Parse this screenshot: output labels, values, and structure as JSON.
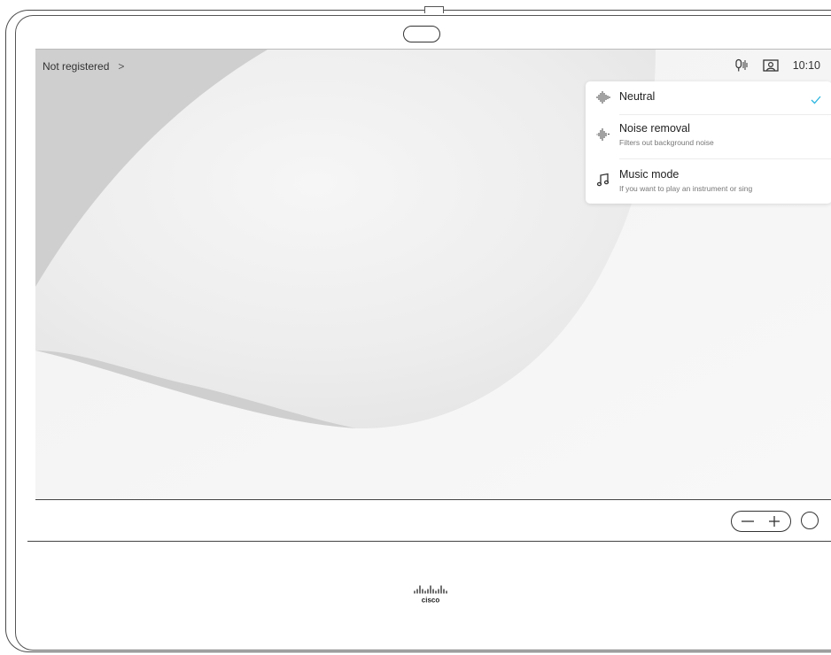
{
  "status_bar": {
    "registration_label": "Not registered",
    "registration_chevron": ">",
    "time": "10:10",
    "icons": [
      "microphone-noise-icon",
      "self-view-icon"
    ]
  },
  "audio_menu": {
    "options": [
      {
        "title": "Neutral",
        "subtitle": "",
        "icon": "waveform-icon",
        "selected": true
      },
      {
        "title": "Noise removal",
        "subtitle": "Filters out background noise",
        "icon": "waveform-filtered-icon",
        "selected": false
      },
      {
        "title": "Music mode",
        "subtitle": "If you want to play an instrument or sing",
        "icon": "music-note-icon",
        "selected": false
      }
    ]
  },
  "colors": {
    "check_accent": "#2cb5e0",
    "wallpaper_gray": "#cfcfcf",
    "outline": "#444444"
  },
  "hardware": {
    "volume_minus": "−",
    "volume_plus": "+",
    "brand": "cisco"
  }
}
